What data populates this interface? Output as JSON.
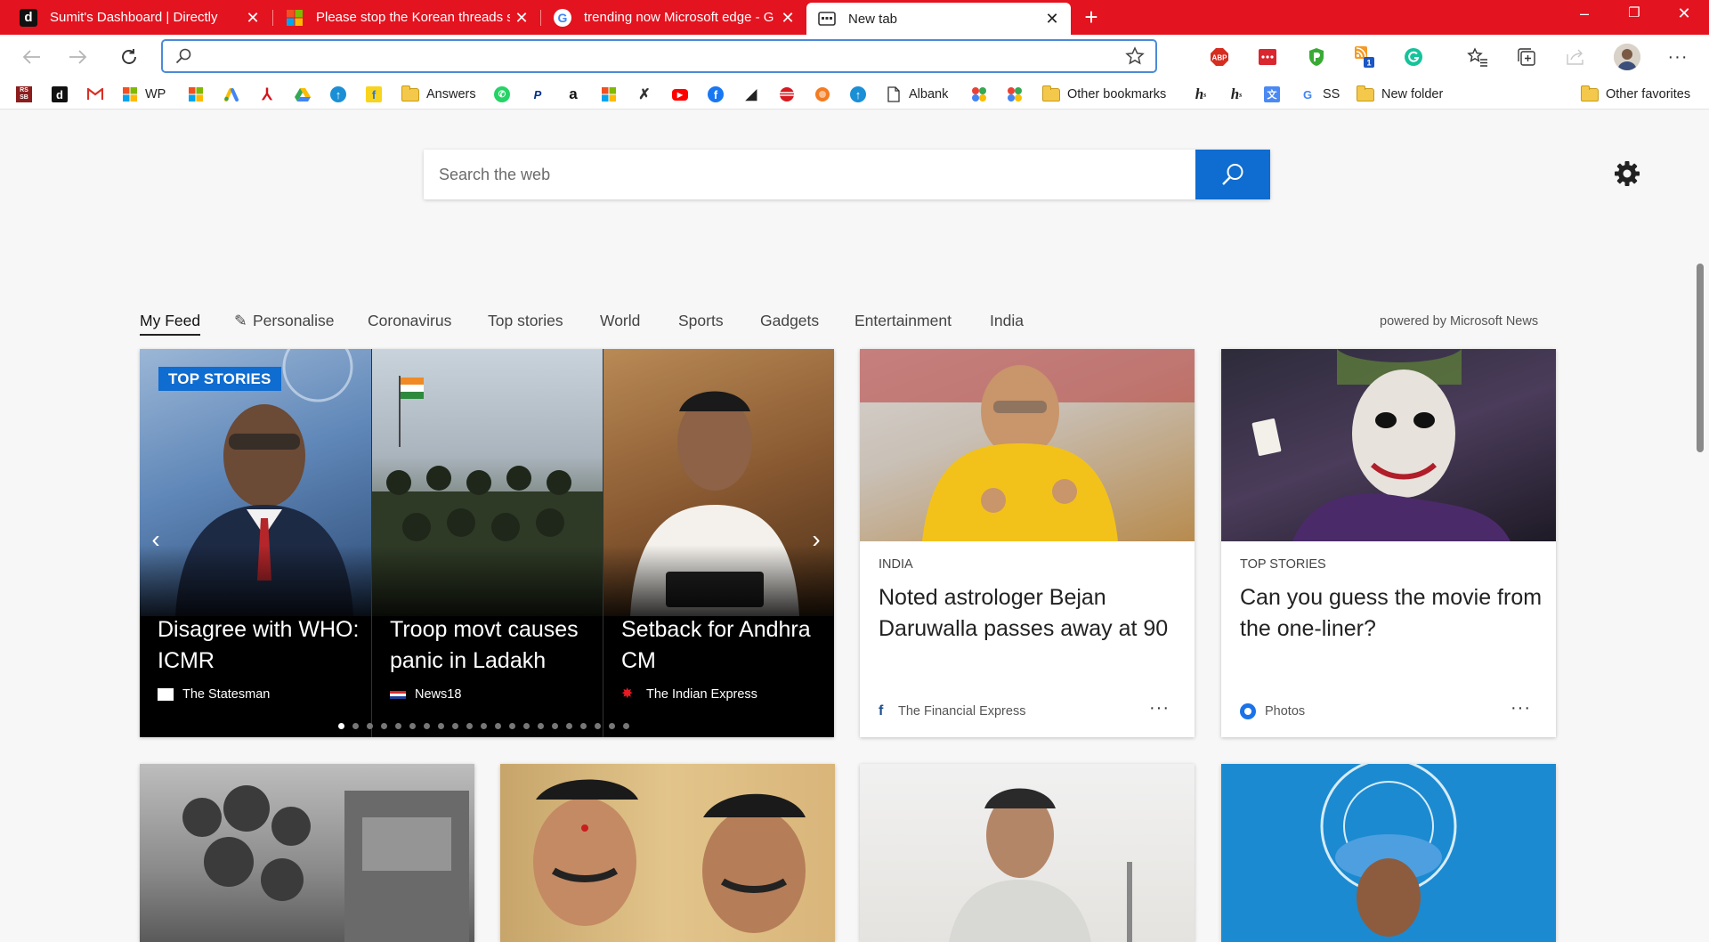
{
  "browser": {
    "tabs": [
      {
        "title": "Sumit's Dashboard | Directly",
        "icon": "directly-d-icon"
      },
      {
        "title": "Please stop the Korean threads s",
        "icon": "microsoft-logo-icon"
      },
      {
        "title": "trending now Microsoft edge - G",
        "icon": "google-g-icon"
      },
      {
        "title": "New tab",
        "icon": "new-tab-page-icon"
      }
    ],
    "address": {
      "value": "",
      "placeholder": ""
    },
    "extensions": [
      "adblock-plus-icon",
      "ellipsis-red-icon",
      "shield-green-icon",
      "rss-badge-icon",
      "grammarly-icon",
      "favorites-icon",
      "collections-icon",
      "share-icon",
      "profile-avatar-icon",
      "settings-more-icon"
    ],
    "extension_badges": {
      "rss": "1",
      "adblock": "ABP"
    }
  },
  "bookmarks": {
    "items": [
      {
        "label": "WP"
      },
      {
        "label": "Answers"
      },
      {
        "label": "Albank"
      },
      {
        "label": "Other bookmarks"
      },
      {
        "label": "SS"
      },
      {
        "label": "New folder"
      }
    ],
    "other_favorites": "Other favorites"
  },
  "newtab": {
    "search_placeholder": "Search the web",
    "feed_nav": [
      "My Feed",
      "Personalise",
      "Coronavirus",
      "Top stories",
      "World",
      "Sports",
      "Gadgets",
      "Entertainment",
      "India"
    ],
    "powered_by": "powered by Microsoft News",
    "hero": {
      "badge": "TOP STORIES",
      "slides": [
        {
          "title": "Disagree with WHO: ICMR",
          "source": "The Statesman"
        },
        {
          "title": "Troop movt causes panic in Ladakh",
          "source": "News18"
        },
        {
          "title": "Setback for Andhra CM",
          "source": "The Indian Express"
        }
      ],
      "dot_count": 21,
      "active_dot": 1
    },
    "cards": [
      {
        "category": "INDIA",
        "title": "Noted astrologer Bejan Daruwalla passes away at 90",
        "source": "The Financial Express"
      },
      {
        "category": "TOP STORIES",
        "title": "Can you guess the movie from the one-liner?",
        "source": "Photos"
      }
    ],
    "more_label": "···"
  },
  "colors": {
    "edge_red": "#e3131f",
    "accent_blue": "#0f6cd0"
  }
}
